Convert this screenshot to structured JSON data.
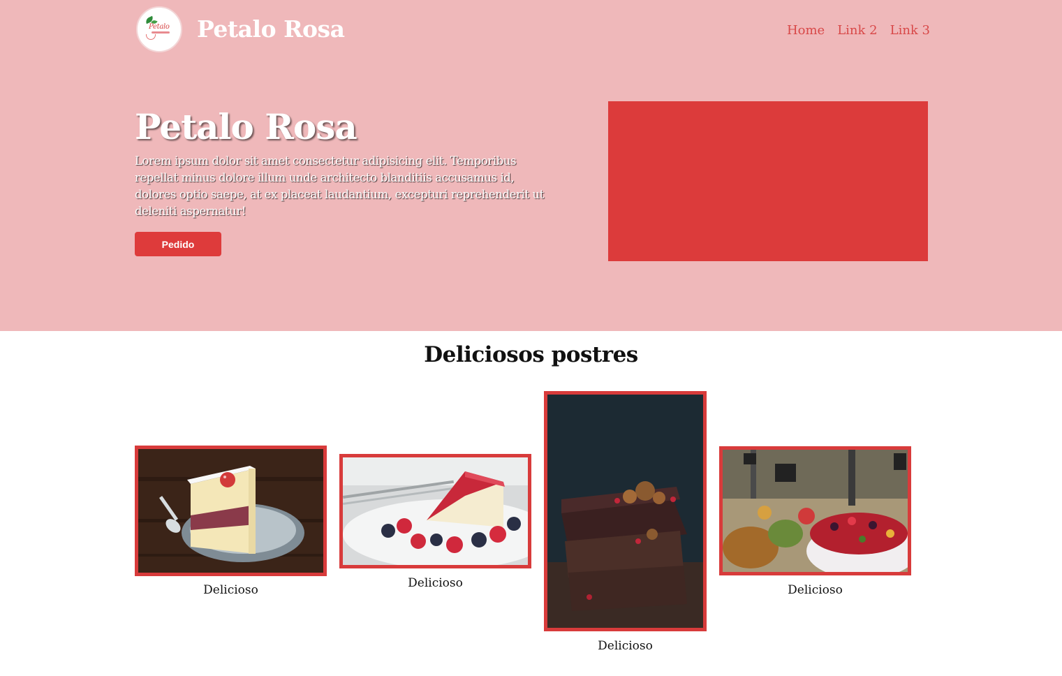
{
  "header": {
    "brand": "Petalo Rosa",
    "logo_text": "Petalo",
    "nav": [
      "Home",
      "Link 2",
      "Link 3"
    ]
  },
  "hero": {
    "title": "Petalo Rosa",
    "text": "Lorem ipsum dolor sit amet consectetur adipisicing elit. Temporibus repellat minus dolore illum unde architecto blanditiis accusamus id, dolores optio saepe, at ex placeat laudantium, excepturi reprehenderit ut deleniti aspernatur!",
    "button": "Pedido"
  },
  "section": {
    "title": "Deliciosos postres",
    "cards": [
      {
        "caption": "Delicioso",
        "image": "cake-slice-with-strawberry"
      },
      {
        "caption": "Delicioso",
        "image": "cheesecake-with-berries"
      },
      {
        "caption": "Delicioso",
        "image": "stacked-brownies"
      },
      {
        "caption": "Delicioso",
        "image": "dessert-buffet-table"
      }
    ]
  },
  "colors": {
    "hero_background": "#efb8ba",
    "accent": "#de3b3b",
    "nav_link": "#d84848",
    "card_border": "#d83b3b"
  }
}
